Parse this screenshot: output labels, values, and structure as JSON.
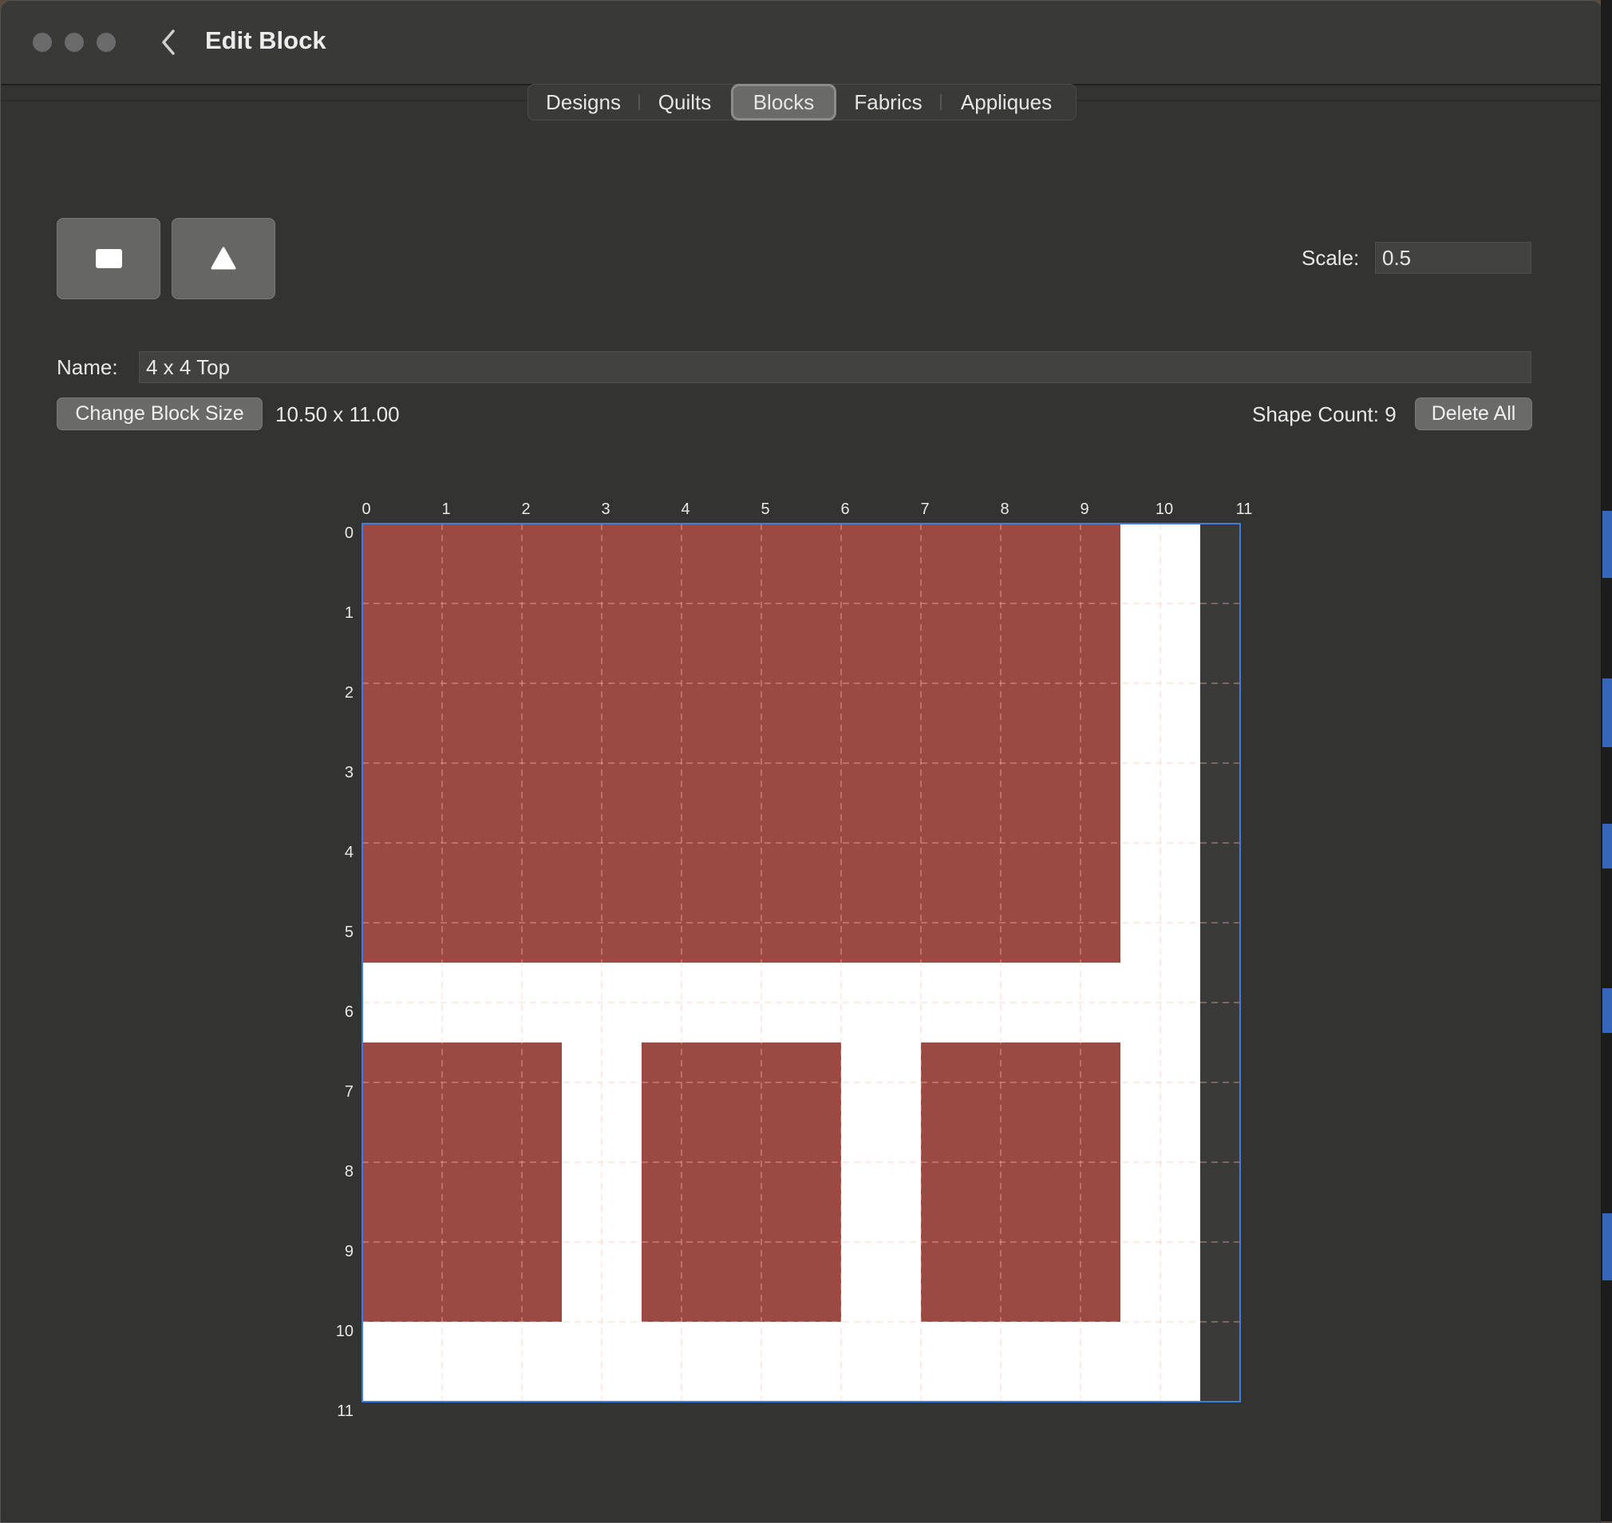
{
  "window": {
    "title": "Edit Block"
  },
  "tabs": [
    {
      "label": "Designs",
      "active": false
    },
    {
      "label": "Quilts",
      "active": false
    },
    {
      "label": "Blocks",
      "active": true
    },
    {
      "label": "Fabrics",
      "active": false
    },
    {
      "label": "Appliques",
      "active": false
    }
  ],
  "tools": {
    "rectangle_icon": "filled-square-icon",
    "triangle_icon": "filled-triangle-icon"
  },
  "scale": {
    "label": "Scale:",
    "value": "0.5"
  },
  "name": {
    "label": "Name:",
    "value": "4 x 4 Top"
  },
  "block": {
    "change_size_label": "Change Block Size",
    "size_text": "10.50 x 11.00",
    "shape_count_text": "Shape Count: 9",
    "delete_all_label": "Delete All"
  },
  "ruler": {
    "x_ticks": [
      "0",
      "1",
      "2",
      "3",
      "4",
      "5",
      "6",
      "7",
      "8",
      "9",
      "10",
      "11"
    ],
    "y_ticks": [
      "0",
      "1",
      "2",
      "3",
      "4",
      "5",
      "6",
      "7",
      "8",
      "9",
      "10",
      "11"
    ]
  },
  "canvas": {
    "block_width": 10.5,
    "block_height": 11,
    "fabric_color": "#9a4a43",
    "background_color": "#ffffff",
    "shapes": [
      {
        "x": 0,
        "y": 0,
        "w": 9.5,
        "h": 5.5
      },
      {
        "x": 0,
        "y": 6.5,
        "w": 2.5,
        "h": 3.5
      },
      {
        "x": 3.5,
        "y": 6.5,
        "w": 2.5,
        "h": 3.5
      },
      {
        "x": 7,
        "y": 6.5,
        "w": 2.5,
        "h": 3.5
      }
    ]
  },
  "colors": {
    "accent": "#3f7ce0",
    "window_bg": "#333332",
    "button_bg": "#6a6a69"
  }
}
